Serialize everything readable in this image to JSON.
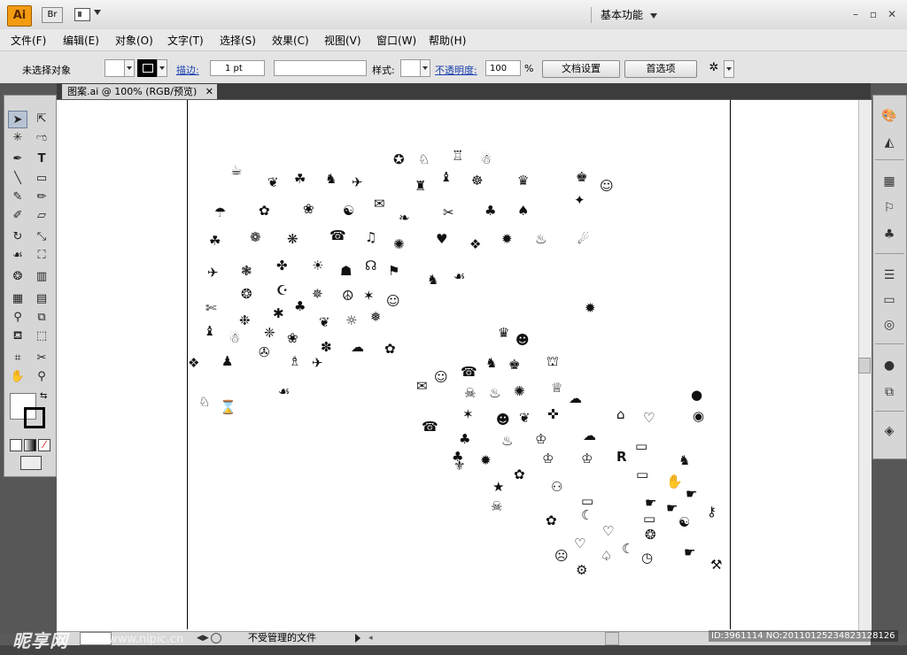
{
  "titlebar": {
    "app_logo": "Ai",
    "bridge": "Br",
    "workspace": "基本功能",
    "minimize": "–",
    "restore": "▫",
    "close": "✕"
  },
  "menu": [
    "文件(F)",
    "编辑(E)",
    "对象(O)",
    "文字(T)",
    "选择(S)",
    "效果(C)",
    "视图(V)",
    "窗口(W)",
    "帮助(H)"
  ],
  "control": {
    "selection_status": "未选择对象",
    "stroke_label": "描边:",
    "stroke_value": "1 pt",
    "style_label": "样式:",
    "opacity_label": "不透明度:",
    "opacity_value": "100",
    "opacity_unit": "%",
    "doc_setup": "文档设置",
    "preferences": "首选项"
  },
  "document": {
    "tab_title": "图案.ai @ 100% (RGB/预览)",
    "tab_close": "✕"
  },
  "status": {
    "text": "不受管理的文件"
  },
  "watermark": {
    "brand": "昵享网",
    "url": "www.nipic.cn",
    "image_id": "ID:3961114 NO:20110125234823128126"
  },
  "colors": {
    "accent": "#f39c12",
    "link": "#1a40b0"
  },
  "icons": {
    "tools": [
      "selection-tool",
      "direct-selection-tool",
      "magic-wand-tool",
      "lasso-tool",
      "pen-tool",
      "type-tool",
      "line-tool",
      "rectangle-tool",
      "paintbrush-tool",
      "pencil-tool",
      "blob-brush-tool",
      "eraser-tool",
      "rotate-tool",
      "scale-tool",
      "warp-tool",
      "free-transform-tool",
      "symbol-sprayer-tool",
      "graph-tool",
      "mesh-tool",
      "gradient-tool",
      "eyedropper-tool",
      "blend-tool",
      "live-paint-tool",
      "slice-tool",
      "artboard-tool",
      "scissors-tool",
      "hand-tool",
      "zoom-tool"
    ],
    "right_panels": [
      "color-panel",
      "color-guide-panel",
      "swatches-panel",
      "brushes-panel",
      "symbols-panel",
      "stroke-panel",
      "gradient-panel",
      "transparency-panel",
      "appearance-panel",
      "graphic-styles-panel",
      "layers-panel"
    ]
  }
}
